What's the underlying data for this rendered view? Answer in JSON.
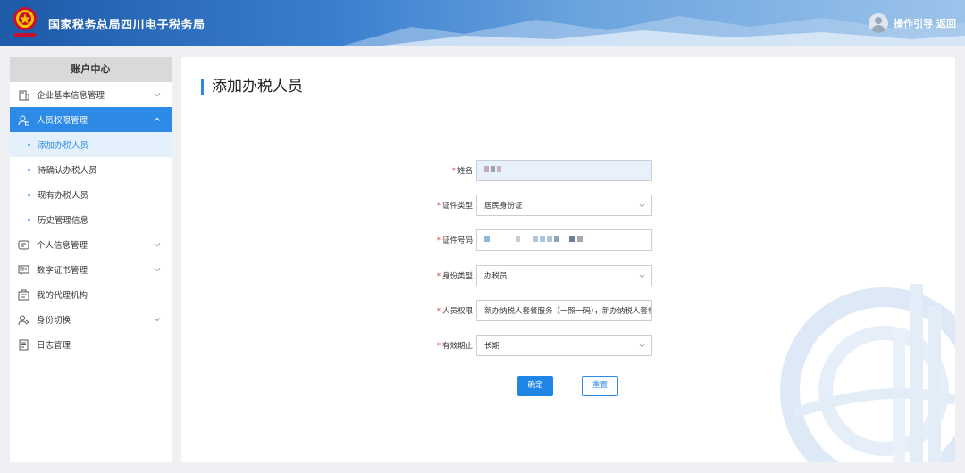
{
  "header": {
    "title": "国家税务总局四川电子税务局",
    "user_links": "操作引导 返回",
    "colors": {
      "bar_start": "#1d5aa8",
      "bar_end": "#9cc3ea"
    }
  },
  "sidebar": {
    "heading": "账户中心",
    "items": [
      {
        "label": "企业基本信息管理",
        "icon": "building-icon",
        "expanded": false
      },
      {
        "label": "人员权限管理",
        "icon": "user-lock-icon",
        "expanded": true,
        "active": true,
        "children": [
          {
            "label": "添加办税人员",
            "active": true
          },
          {
            "label": "待确认办税人员"
          },
          {
            "label": "现有办税人员"
          },
          {
            "label": "历史管理信息"
          }
        ]
      },
      {
        "label": "个人信息管理",
        "icon": "id-card-icon",
        "expanded": false
      },
      {
        "label": "数字证书管理",
        "icon": "certificate-icon",
        "expanded": false
      },
      {
        "label": "我的代理机构",
        "icon": "agency-icon"
      },
      {
        "label": "身份切换",
        "icon": "switch-icon",
        "expanded": false
      },
      {
        "label": "日志管理",
        "icon": "log-icon"
      }
    ]
  },
  "main": {
    "title": "添加办税人员",
    "form": {
      "name": {
        "label": "姓名",
        "value": ""
      },
      "id_type": {
        "label": "证件类型",
        "value": "居民身份证"
      },
      "id_number": {
        "label": "证件号码",
        "value": ""
      },
      "role": {
        "label": "身份类型",
        "value": "办税员"
      },
      "permission": {
        "label": "人员权限",
        "value": "新办纳税人套餐服务（一照一码），新办纳税人套餐"
      },
      "validity": {
        "label": "有效期止",
        "value": "长期"
      }
    },
    "buttons": {
      "confirm": "确定",
      "reset": "重置"
    }
  }
}
